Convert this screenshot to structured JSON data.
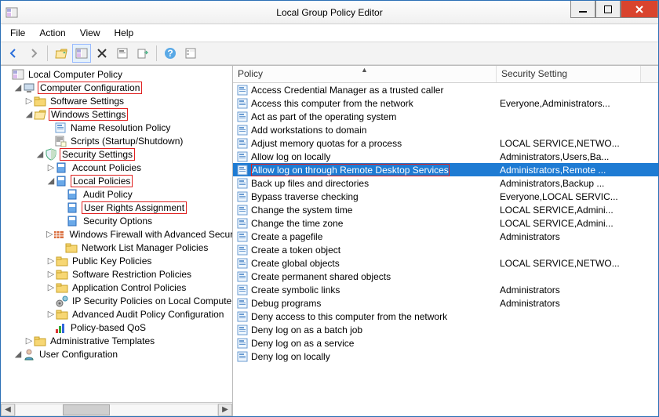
{
  "title": "Local Group Policy Editor",
  "menu": [
    "File",
    "Action",
    "View",
    "Help"
  ],
  "tree": {
    "root": "Local Computer Policy",
    "computer_config": "Computer Configuration",
    "software_settings": "Software Settings",
    "windows_settings": "Windows Settings",
    "name_resolution": "Name Resolution Policy",
    "scripts": "Scripts (Startup/Shutdown)",
    "security_settings": "Security Settings",
    "account_policies": "Account Policies",
    "local_policies": "Local Policies",
    "audit_policy": "Audit Policy",
    "user_rights": "User Rights Assignment",
    "security_options": "Security Options",
    "windows_firewall": "Windows Firewall with Advanced Security",
    "network_list": "Network List Manager Policies",
    "public_key": "Public Key Policies",
    "software_restriction": "Software Restriction Policies",
    "application_control": "Application Control Policies",
    "ip_security": "IP Security Policies on Local Computer",
    "advanced_audit": "Advanced Audit Policy Configuration",
    "policy_qos": "Policy-based QoS",
    "admin_templates": "Administrative Templates",
    "user_config": "User Configuration"
  },
  "columns": {
    "policy": "Policy",
    "security": "Security Setting"
  },
  "policies": [
    {
      "name": "Access Credential Manager as a trusted caller",
      "setting": ""
    },
    {
      "name": "Access this computer from the network",
      "setting": "Everyone,Administrators..."
    },
    {
      "name": "Act as part of the operating system",
      "setting": ""
    },
    {
      "name": "Add workstations to domain",
      "setting": ""
    },
    {
      "name": "Adjust memory quotas for a process",
      "setting": "LOCAL SERVICE,NETWO..."
    },
    {
      "name": "Allow log on locally",
      "setting": "Administrators,Users,Ba..."
    },
    {
      "name": "Allow log on through Remote Desktop Services",
      "setting": "Administrators,Remote ...",
      "selected": true,
      "boxed": true
    },
    {
      "name": "Back up files and directories",
      "setting": "Administrators,Backup ..."
    },
    {
      "name": "Bypass traverse checking",
      "setting": "Everyone,LOCAL SERVIC..."
    },
    {
      "name": "Change the system time",
      "setting": "LOCAL SERVICE,Admini..."
    },
    {
      "name": "Change the time zone",
      "setting": "LOCAL SERVICE,Admini..."
    },
    {
      "name": "Create a pagefile",
      "setting": "Administrators"
    },
    {
      "name": "Create a token object",
      "setting": ""
    },
    {
      "name": "Create global objects",
      "setting": "LOCAL SERVICE,NETWO..."
    },
    {
      "name": "Create permanent shared objects",
      "setting": ""
    },
    {
      "name": "Create symbolic links",
      "setting": "Administrators"
    },
    {
      "name": "Debug programs",
      "setting": "Administrators"
    },
    {
      "name": "Deny access to this computer from the network",
      "setting": ""
    },
    {
      "name": "Deny log on as a batch job",
      "setting": ""
    },
    {
      "name": "Deny log on as a service",
      "setting": ""
    },
    {
      "name": "Deny log on locally",
      "setting": ""
    }
  ]
}
